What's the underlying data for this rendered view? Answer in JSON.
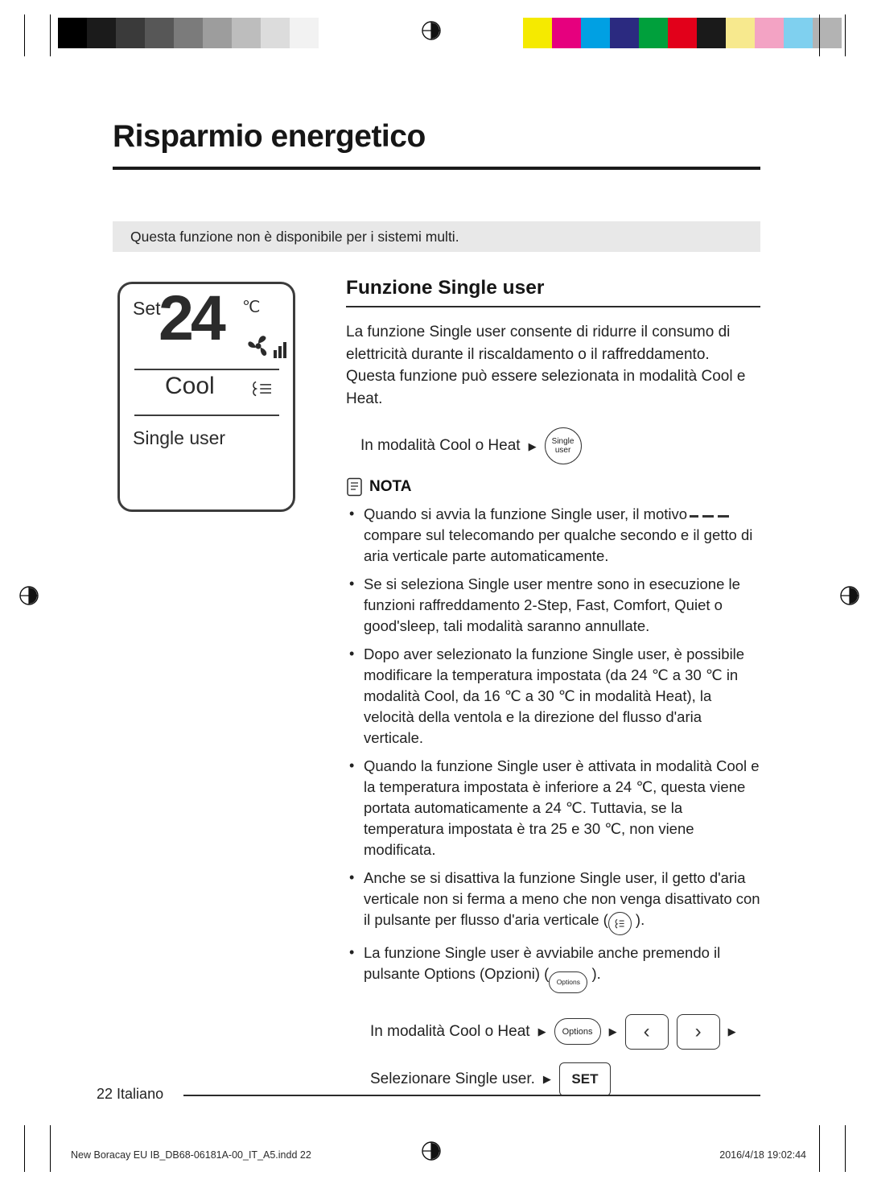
{
  "print_marks": {
    "gray_swatches": [
      "#000000",
      "#1b1b1b",
      "#3a3a3a",
      "#575757",
      "#7b7b7b",
      "#9d9d9d",
      "#bdbdbd",
      "#dcdcdc",
      "#f2f2f2",
      "#ffffff"
    ],
    "color_swatches": [
      "#f5ea00",
      "#e6007e",
      "#00a0e3",
      "#2b2a80",
      "#00a03c",
      "#e2001a",
      "#1a1a1a",
      "#f7e98e",
      "#f3a3c4",
      "#7fd0ef",
      "#b3b3b3"
    ]
  },
  "page": {
    "title": "Risparmio energetico",
    "notice": "Questa funzione non è disponibile per i sistemi multi.",
    "footer": {
      "page_number": "22",
      "language": "Italiano",
      "filename": "New Boracay EU IB_DB68-06181A-00_IT_A5.indd   22",
      "timestamp": "2016/4/18   19:02:44"
    }
  },
  "remote_display": {
    "set_label": "Set",
    "temperature": "24",
    "unit": "℃",
    "mode": "Cool",
    "function": "Single user"
  },
  "section": {
    "heading": "Funzione Single user",
    "intro": "La funzione Single user consente di ridurre il consumo di elettricità durante il riscaldamento o il raffreddamento. Questa funzione può essere selezionata in modalità Cool e Heat.",
    "step_main": {
      "text": "In modalità Cool o Heat",
      "arrow": "▶",
      "button_line1": "Single",
      "button_line2": "user"
    },
    "note_label": "NOTA",
    "notes": [
      "Quando si avvia la funzione Single user, il motivo  compare sul telecomando per qualche secondo e il getto di aria verticale parte automaticamente.",
      "Se si seleziona Single user mentre sono in esecuzione le funzioni raffreddamento 2-Step, Fast, Comfort, Quiet o good'sleep, tali modalità saranno annullate.",
      "Dopo aver selezionato la funzione Single user, è possibile modificare la temperatura impostata (da 24 ℃ a 30 ℃ in modalità Cool, da 16 ℃ a 30 ℃ in modalità Heat), la velocità della ventola e la direzione del flusso d'aria verticale.",
      "Quando la funzione Single user è attivata in modalità Cool e la temperatura impostata è inferiore a 24 ℃, questa viene portata automaticamente a 24 ℃. Tuttavia, se la temperatura impostata è tra 25 e 30 ℃, non viene modificata.",
      "Anche se si disattiva la funzione Single user, il getto d'aria verticale non si ferma a meno che non venga disattivato con il pulsante per flusso d'aria verticale ( ).",
      "La funzione Single user è avviabile anche premendo il pulsante Options (Opzioni) ( )."
    ],
    "steps_bottom": [
      {
        "text": "In modalità Cool o Heat",
        "buttons": [
          "Options",
          "‹",
          "›"
        ]
      },
      {
        "text": "Selezionare Single user.",
        "buttons": [
          "SET"
        ]
      }
    ]
  }
}
